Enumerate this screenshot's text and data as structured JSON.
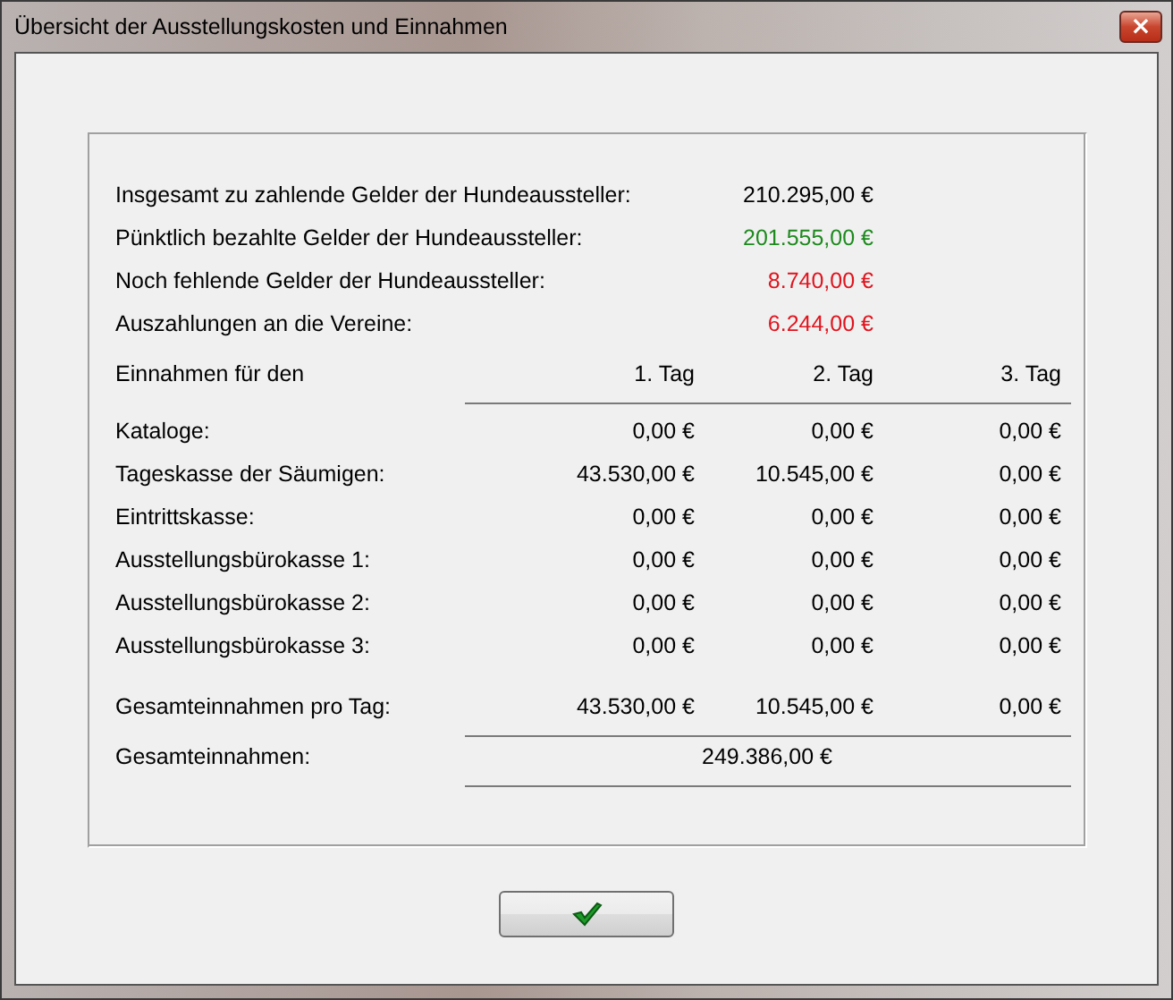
{
  "window": {
    "title": "Übersicht der Ausstellungskosten und Einnahmen",
    "close": "×"
  },
  "summary": [
    {
      "label": "Insgesamt zu zahlende Gelder der Hundeaussteller:",
      "value": "210.295,00 €",
      "color": "#000000"
    },
    {
      "label": "Pünktlich bezahlte Gelder der Hundeaussteller:",
      "value": "201.555,00 €",
      "color": "#1e8a1e"
    },
    {
      "label": "Noch fehlende Gelder der Hundeaussteller:",
      "value": "8.740,00 €",
      "color": "#e0141e"
    },
    {
      "label": "Auszahlungen an die Vereine:",
      "value": "6.244,00 €",
      "color": "#e0141e"
    }
  ],
  "income": {
    "heading": "Einnahmen für den",
    "days": [
      "1. Tag",
      "2. Tag",
      "3. Tag"
    ],
    "rows": [
      {
        "label": "Kataloge:",
        "values": [
          "0,00 €",
          "0,00 €",
          "0,00 €"
        ]
      },
      {
        "label": "Tageskasse der Säumigen:",
        "values": [
          "43.530,00 €",
          "10.545,00 €",
          "0,00 €"
        ]
      },
      {
        "label": "Eintrittskasse:",
        "values": [
          "0,00 €",
          "0,00 €",
          "0,00 €"
        ]
      },
      {
        "label": "Ausstellungsbürokasse 1:",
        "values": [
          "0,00 €",
          "0,00 €",
          "0,00 €"
        ]
      },
      {
        "label": "Ausstellungsbürokasse 2:",
        "values": [
          "0,00 €",
          "0,00 €",
          "0,00 €"
        ]
      },
      {
        "label": "Ausstellungsbürokasse 3:",
        "values": [
          "0,00 €",
          "0,00 €",
          "0,00 €"
        ]
      }
    ],
    "per_day": {
      "label": "Gesamteinnahmen pro Tag:",
      "values": [
        "43.530,00 €",
        "10.545,00 €",
        "0,00 €"
      ]
    },
    "grand_total": {
      "label": "Gesamteinnahmen:",
      "value": "249.386,00 €"
    }
  }
}
